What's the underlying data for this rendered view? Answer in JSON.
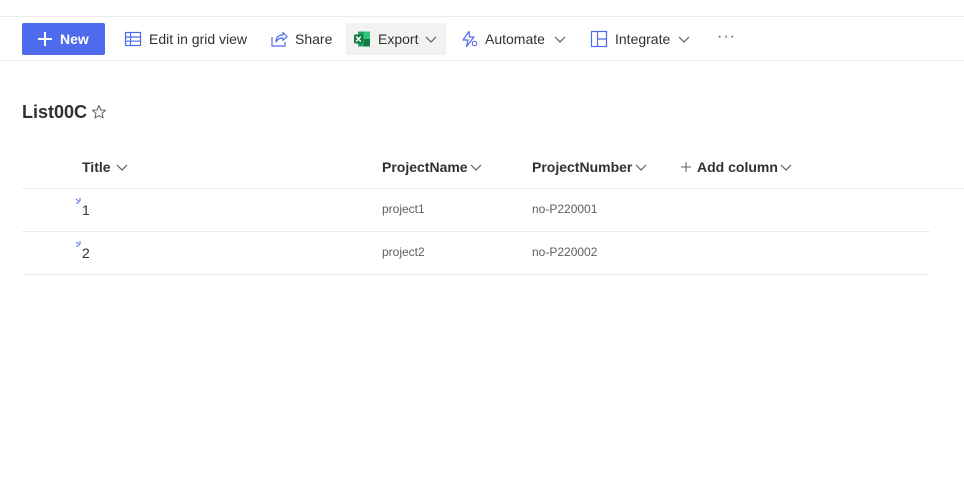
{
  "toolbar": {
    "new_label": "New",
    "grid_label": "Edit in grid view",
    "share_label": "Share",
    "export_label": "Export",
    "automate_label": "Automate",
    "integrate_label": "Integrate",
    "more_label": "···"
  },
  "list": {
    "title": "List00C"
  },
  "columns": {
    "title": "Title",
    "project_name": "ProjectName",
    "project_number": "ProjectNumber",
    "add_column": "Add column"
  },
  "rows": [
    {
      "title": "1",
      "project_name": "project1",
      "project_number": "no-P220001"
    },
    {
      "title": "2",
      "project_name": "project2",
      "project_number": "no-P220002"
    }
  ],
  "colors": {
    "accent": "#4f6bed",
    "excel_green": "#107c41",
    "divider": "#edebe9"
  }
}
